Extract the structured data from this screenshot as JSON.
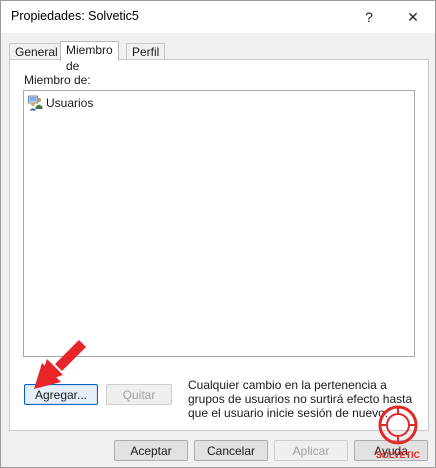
{
  "window": {
    "title": "Propiedades: Solvetic5",
    "help_glyph": "?",
    "close_glyph": "✕"
  },
  "tabs": [
    {
      "label": "General",
      "active": false
    },
    {
      "label": "Miembro de",
      "active": true
    },
    {
      "label": "Perfil",
      "active": false
    }
  ],
  "member_of": {
    "label": "Miembro de:",
    "items": [
      {
        "label": "Usuarios",
        "icon": "users-group-icon"
      }
    ]
  },
  "actions": {
    "add_label": "Agregar...",
    "remove_label": "Quitar",
    "note": "Cualquier cambio en la pertenencia a grupos de usuarios no surtirá efecto hasta que el usuario inicie sesión de nuevo."
  },
  "footer": {
    "ok_label": "Aceptar",
    "cancel_label": "Cancelar",
    "apply_label": "Aplicar",
    "help_label": "Ayuda"
  },
  "colors": {
    "annotation_arrow": "#e8262a",
    "watermark": "#e02a2a"
  },
  "watermark_text": "SOLVETIC"
}
